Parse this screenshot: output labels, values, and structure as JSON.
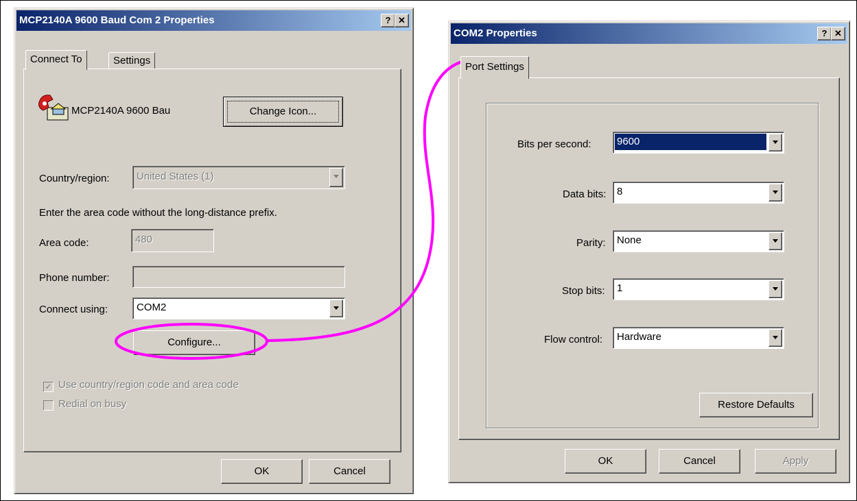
{
  "left_dialog": {
    "title": "MCP2140A 9600 Baud Com 2 Properties",
    "help_btn": "?",
    "close_btn": "✕",
    "tabs": [
      "Connect To",
      "Settings"
    ],
    "connection_name": "MCP2140A 9600 Bau",
    "change_icon_label": "Change Icon...",
    "country_label": "Country/region:",
    "country_value": "United States (1)",
    "area_code_hint": "Enter the area code without the long-distance prefix.",
    "area_code_label": "Area code:",
    "area_code_value": "480",
    "phone_label": "Phone number:",
    "phone_value": "",
    "connect_using_label": "Connect using:",
    "connect_using_value": "COM2",
    "configure_label": "Configure...",
    "use_country_checkbox": "Use country/region code and area code",
    "redial_checkbox": "Redial on busy",
    "ok_label": "OK",
    "cancel_label": "Cancel"
  },
  "right_dialog": {
    "title": "COM2 Properties",
    "help_btn": "?",
    "close_btn": "✕",
    "tab": "Port Settings",
    "bits_per_second_label": "Bits per second:",
    "bits_per_second_value": "9600",
    "data_bits_label": "Data bits:",
    "data_bits_value": "8",
    "parity_label": "Parity:",
    "parity_value": "None",
    "stop_bits_label": "Stop bits:",
    "stop_bits_value": "1",
    "flow_control_label": "Flow control:",
    "flow_control_value": "Hardware",
    "restore_defaults_label": "Restore Defaults",
    "ok_label": "OK",
    "cancel_label": "Cancel",
    "apply_label": "Apply"
  },
  "annotation_color": "#ff00ff"
}
